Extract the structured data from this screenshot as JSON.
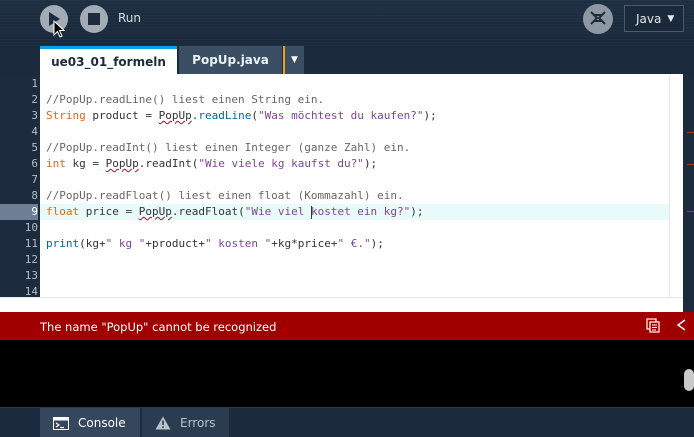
{
  "toolbar": {
    "run_label": "Run",
    "mode_icon": "experimental-mode-icon",
    "language": "Java"
  },
  "tabs": [
    {
      "label": "ue03_01_formeln",
      "active": true
    },
    {
      "label": "PopUp.java",
      "active": false
    }
  ],
  "editor": {
    "line_numbers": [
      "1",
      "2",
      "3",
      "4",
      "5",
      "6",
      "7",
      "8",
      "9",
      "10",
      "11",
      "12",
      "13",
      "14"
    ],
    "current_line": 9,
    "lines": [
      "",
      "//PopUp.readLine() liest einen String ein.",
      "String product = PopUp.readLine(\"Was möchtest du kaufen?\");",
      "",
      "//PopUp.readInt() liest einen Integer (ganze Zahl) ein.",
      "int kg = PopUp.readInt(\"Wie viele kg kaufst du?\");",
      "",
      "//PopUp.readFloat() liest einen float (Kommazahl) ein.",
      "float price = PopUp.readFloat(\"Wie viel kostet ein kg?\");",
      "",
      "print(kg+\" kg \"+product+\" kosten \"+kg*price+\" €.\");",
      "",
      "",
      ""
    ]
  },
  "error_bar": {
    "message": "The name \"PopUp\" cannot be recognized",
    "color": "#a10000"
  },
  "bottom_tabs": [
    {
      "label": "Console",
      "icon": "console-icon",
      "active": true
    },
    {
      "label": "Errors",
      "icon": "warning-icon",
      "active": false
    }
  ],
  "colors": {
    "accent": "#00a2e8",
    "tab_marker": "#f0a020",
    "comment": "#666666",
    "type": "#e2661a",
    "function": "#006699",
    "string": "#7d4793"
  }
}
